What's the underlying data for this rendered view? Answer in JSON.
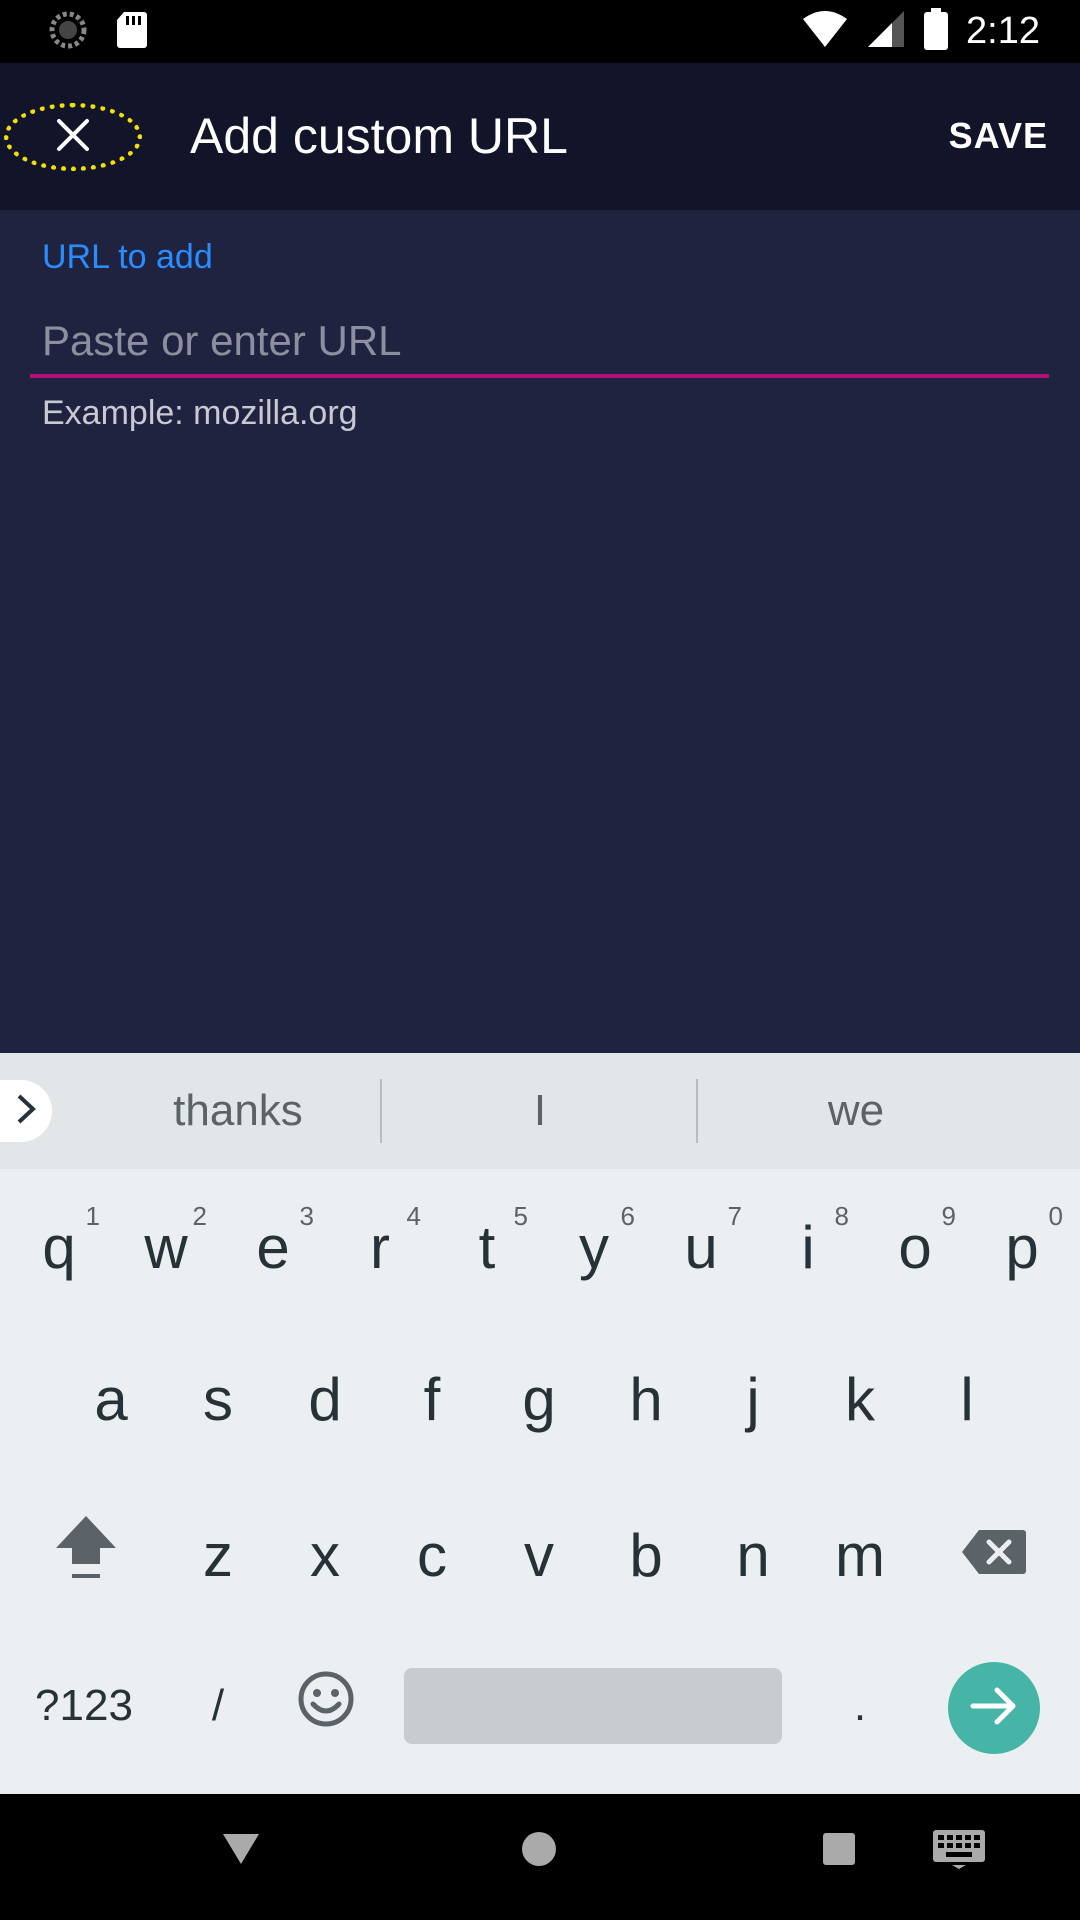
{
  "status_bar": {
    "time": "2:12",
    "icons": [
      "loading-icon",
      "sd-card-icon",
      "wifi-icon",
      "cell-signal-icon",
      "battery-icon"
    ]
  },
  "app_bar": {
    "title": "Add custom URL",
    "save_label": "SAVE",
    "close_icon": "close-icon",
    "highlight_color": "#f5e100"
  },
  "form": {
    "label": "URL to add",
    "input_value": "",
    "placeholder": "Paste or enter URL",
    "helper": "Example: mozilla.org"
  },
  "keyboard": {
    "suggestions": [
      "thanks",
      "I",
      "we"
    ],
    "row1": [
      {
        "key": "q",
        "hint": "1"
      },
      {
        "key": "w",
        "hint": "2"
      },
      {
        "key": "e",
        "hint": "3"
      },
      {
        "key": "r",
        "hint": "4"
      },
      {
        "key": "t",
        "hint": "5"
      },
      {
        "key": "y",
        "hint": "6"
      },
      {
        "key": "u",
        "hint": "7"
      },
      {
        "key": "i",
        "hint": "8"
      },
      {
        "key": "o",
        "hint": "9"
      },
      {
        "key": "p",
        "hint": "0"
      }
    ],
    "row2": [
      "a",
      "s",
      "d",
      "f",
      "g",
      "h",
      "j",
      "k",
      "l"
    ],
    "row3": [
      "z",
      "x",
      "c",
      "v",
      "b",
      "n",
      "m"
    ],
    "symbols_label": "?123",
    "slash_label": "/",
    "period_label": ".",
    "accent_color": "#47b4a8"
  },
  "nav_bar": {
    "icons": [
      "back-icon",
      "home-icon",
      "recents-icon",
      "keyboard-switch-icon"
    ]
  }
}
